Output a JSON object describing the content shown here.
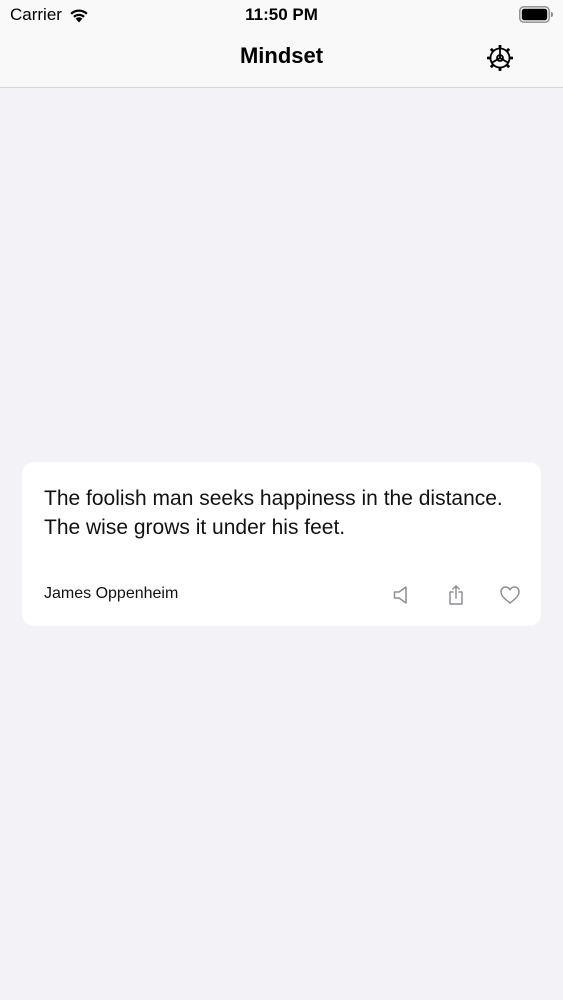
{
  "status_bar": {
    "carrier": "Carrier",
    "time": "11:50 PM",
    "wifi_icon": "wifi-icon",
    "battery_icon": "battery-full-icon"
  },
  "nav": {
    "title": "Mindset",
    "settings_icon": "gear-icon"
  },
  "quote": {
    "text": "The foolish man seeks happiness in the distance. The wise grows it under his feet.",
    "author": "James Oppenheim",
    "actions": {
      "speak_icon": "speaker-icon",
      "share_icon": "share-icon",
      "like_icon": "heart-icon"
    }
  },
  "colors": {
    "background": "#f2f2f7",
    "bar": "#f9f9f9",
    "card": "#ffffff",
    "icon_gray": "#8e8e93"
  }
}
